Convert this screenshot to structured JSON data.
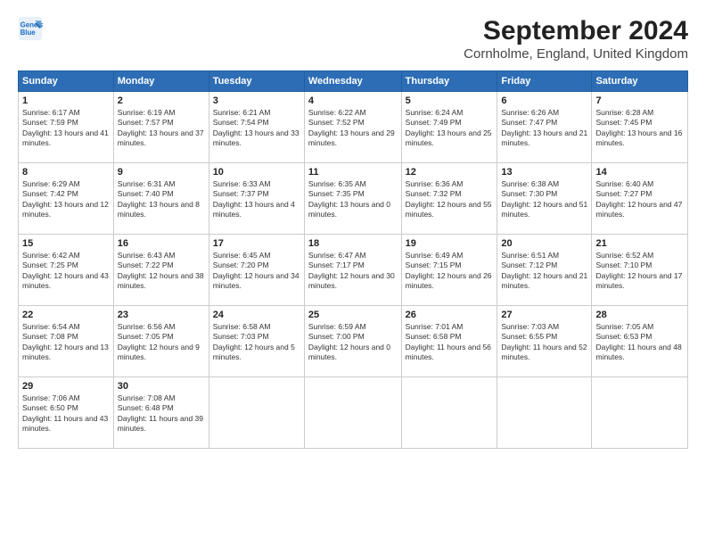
{
  "header": {
    "logo_line1": "General",
    "logo_line2": "Blue",
    "main_title": "September 2024",
    "subtitle": "Cornholme, England, United Kingdom"
  },
  "columns": [
    "Sunday",
    "Monday",
    "Tuesday",
    "Wednesday",
    "Thursday",
    "Friday",
    "Saturday"
  ],
  "weeks": [
    [
      {
        "day": "1",
        "sunrise": "Sunrise: 6:17 AM",
        "sunset": "Sunset: 7:59 PM",
        "daylight": "Daylight: 13 hours and 41 minutes."
      },
      {
        "day": "2",
        "sunrise": "Sunrise: 6:19 AM",
        "sunset": "Sunset: 7:57 PM",
        "daylight": "Daylight: 13 hours and 37 minutes."
      },
      {
        "day": "3",
        "sunrise": "Sunrise: 6:21 AM",
        "sunset": "Sunset: 7:54 PM",
        "daylight": "Daylight: 13 hours and 33 minutes."
      },
      {
        "day": "4",
        "sunrise": "Sunrise: 6:22 AM",
        "sunset": "Sunset: 7:52 PM",
        "daylight": "Daylight: 13 hours and 29 minutes."
      },
      {
        "day": "5",
        "sunrise": "Sunrise: 6:24 AM",
        "sunset": "Sunset: 7:49 PM",
        "daylight": "Daylight: 13 hours and 25 minutes."
      },
      {
        "day": "6",
        "sunrise": "Sunrise: 6:26 AM",
        "sunset": "Sunset: 7:47 PM",
        "daylight": "Daylight: 13 hours and 21 minutes."
      },
      {
        "day": "7",
        "sunrise": "Sunrise: 6:28 AM",
        "sunset": "Sunset: 7:45 PM",
        "daylight": "Daylight: 13 hours and 16 minutes."
      }
    ],
    [
      {
        "day": "8",
        "sunrise": "Sunrise: 6:29 AM",
        "sunset": "Sunset: 7:42 PM",
        "daylight": "Daylight: 13 hours and 12 minutes."
      },
      {
        "day": "9",
        "sunrise": "Sunrise: 6:31 AM",
        "sunset": "Sunset: 7:40 PM",
        "daylight": "Daylight: 13 hours and 8 minutes."
      },
      {
        "day": "10",
        "sunrise": "Sunrise: 6:33 AM",
        "sunset": "Sunset: 7:37 PM",
        "daylight": "Daylight: 13 hours and 4 minutes."
      },
      {
        "day": "11",
        "sunrise": "Sunrise: 6:35 AM",
        "sunset": "Sunset: 7:35 PM",
        "daylight": "Daylight: 13 hours and 0 minutes."
      },
      {
        "day": "12",
        "sunrise": "Sunrise: 6:36 AM",
        "sunset": "Sunset: 7:32 PM",
        "daylight": "Daylight: 12 hours and 55 minutes."
      },
      {
        "day": "13",
        "sunrise": "Sunrise: 6:38 AM",
        "sunset": "Sunset: 7:30 PM",
        "daylight": "Daylight: 12 hours and 51 minutes."
      },
      {
        "day": "14",
        "sunrise": "Sunrise: 6:40 AM",
        "sunset": "Sunset: 7:27 PM",
        "daylight": "Daylight: 12 hours and 47 minutes."
      }
    ],
    [
      {
        "day": "15",
        "sunrise": "Sunrise: 6:42 AM",
        "sunset": "Sunset: 7:25 PM",
        "daylight": "Daylight: 12 hours and 43 minutes."
      },
      {
        "day": "16",
        "sunrise": "Sunrise: 6:43 AM",
        "sunset": "Sunset: 7:22 PM",
        "daylight": "Daylight: 12 hours and 38 minutes."
      },
      {
        "day": "17",
        "sunrise": "Sunrise: 6:45 AM",
        "sunset": "Sunset: 7:20 PM",
        "daylight": "Daylight: 12 hours and 34 minutes."
      },
      {
        "day": "18",
        "sunrise": "Sunrise: 6:47 AM",
        "sunset": "Sunset: 7:17 PM",
        "daylight": "Daylight: 12 hours and 30 minutes."
      },
      {
        "day": "19",
        "sunrise": "Sunrise: 6:49 AM",
        "sunset": "Sunset: 7:15 PM",
        "daylight": "Daylight: 12 hours and 26 minutes."
      },
      {
        "day": "20",
        "sunrise": "Sunrise: 6:51 AM",
        "sunset": "Sunset: 7:12 PM",
        "daylight": "Daylight: 12 hours and 21 minutes."
      },
      {
        "day": "21",
        "sunrise": "Sunrise: 6:52 AM",
        "sunset": "Sunset: 7:10 PM",
        "daylight": "Daylight: 12 hours and 17 minutes."
      }
    ],
    [
      {
        "day": "22",
        "sunrise": "Sunrise: 6:54 AM",
        "sunset": "Sunset: 7:08 PM",
        "daylight": "Daylight: 12 hours and 13 minutes."
      },
      {
        "day": "23",
        "sunrise": "Sunrise: 6:56 AM",
        "sunset": "Sunset: 7:05 PM",
        "daylight": "Daylight: 12 hours and 9 minutes."
      },
      {
        "day": "24",
        "sunrise": "Sunrise: 6:58 AM",
        "sunset": "Sunset: 7:03 PM",
        "daylight": "Daylight: 12 hours and 5 minutes."
      },
      {
        "day": "25",
        "sunrise": "Sunrise: 6:59 AM",
        "sunset": "Sunset: 7:00 PM",
        "daylight": "Daylight: 12 hours and 0 minutes."
      },
      {
        "day": "26",
        "sunrise": "Sunrise: 7:01 AM",
        "sunset": "Sunset: 6:58 PM",
        "daylight": "Daylight: 11 hours and 56 minutes."
      },
      {
        "day": "27",
        "sunrise": "Sunrise: 7:03 AM",
        "sunset": "Sunset: 6:55 PM",
        "daylight": "Daylight: 11 hours and 52 minutes."
      },
      {
        "day": "28",
        "sunrise": "Sunrise: 7:05 AM",
        "sunset": "Sunset: 6:53 PM",
        "daylight": "Daylight: 11 hours and 48 minutes."
      }
    ],
    [
      {
        "day": "29",
        "sunrise": "Sunrise: 7:06 AM",
        "sunset": "Sunset: 6:50 PM",
        "daylight": "Daylight: 11 hours and 43 minutes."
      },
      {
        "day": "30",
        "sunrise": "Sunrise: 7:08 AM",
        "sunset": "Sunset: 6:48 PM",
        "daylight": "Daylight: 11 hours and 39 minutes."
      },
      null,
      null,
      null,
      null,
      null
    ]
  ]
}
